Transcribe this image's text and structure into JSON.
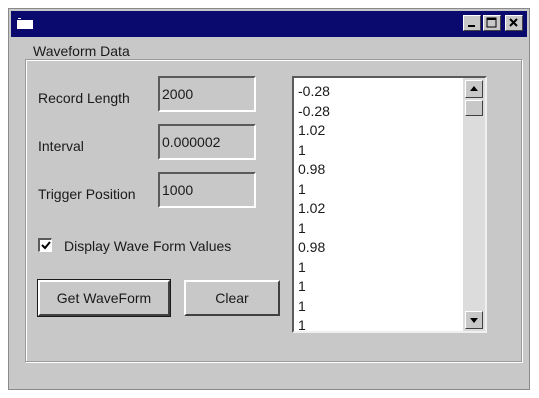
{
  "window": {
    "title": "",
    "colors": {
      "titlebar": "#0a0a6e",
      "face": "#c8c8c8"
    }
  },
  "group": {
    "legend": "Waveform Data"
  },
  "fields": {
    "record_length": {
      "label": "Record Length",
      "value": "2000"
    },
    "interval": {
      "label": "Interval",
      "value": "0.000002"
    },
    "trigger_position": {
      "label": "Trigger Position",
      "value": "1000"
    }
  },
  "display_values": {
    "label": "Display Wave Form Values",
    "checked": true
  },
  "buttons": {
    "get_waveform": "Get WaveForm",
    "clear": "Clear"
  },
  "list": {
    "items": [
      "-0.28",
      "-0.28",
      "1.02",
      "1",
      "0.98",
      "1",
      "1.02",
      "1",
      "0.98",
      "1",
      "1",
      "1",
      "1"
    ]
  },
  "icons": {
    "app": "app-icon",
    "minimize": "minimize-icon",
    "maximize": "maximize-icon",
    "close": "close-icon",
    "scroll_up": "arrow-up-icon",
    "scroll_down": "arrow-down-icon",
    "check": "checkmark-icon"
  }
}
